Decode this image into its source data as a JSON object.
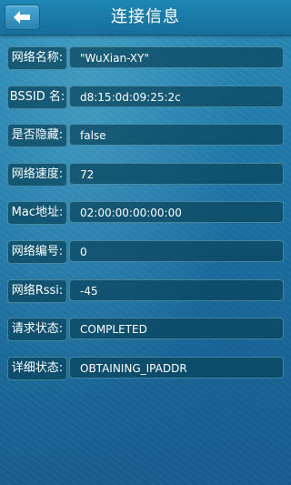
{
  "header": {
    "title": "连接信息",
    "back_icon": "back-arrow-icon"
  },
  "rows": [
    {
      "label": "网络名称:",
      "value": "\"WuXian-XY\""
    },
    {
      "label": "BSSID 名:",
      "value": "d8:15:0d:09:25:2c"
    },
    {
      "label": "是否隐藏:",
      "value": "false"
    },
    {
      "label": "网络速度:",
      "value": "72"
    },
    {
      "label": "Mac地址:",
      "value": "02:00:00:00:00:00"
    },
    {
      "label": "网络编号:",
      "value": "0"
    },
    {
      "label": "网络Rssi:",
      "value": "-45"
    },
    {
      "label": "请求状态:",
      "value": "COMPLETED"
    },
    {
      "label": "详细状态:",
      "value": "OBTAINING_IPADDR"
    }
  ],
  "colors": {
    "background": "#1f78a8",
    "header": "#1a7aa8",
    "field": "#08445c",
    "text": "#ffffff"
  }
}
